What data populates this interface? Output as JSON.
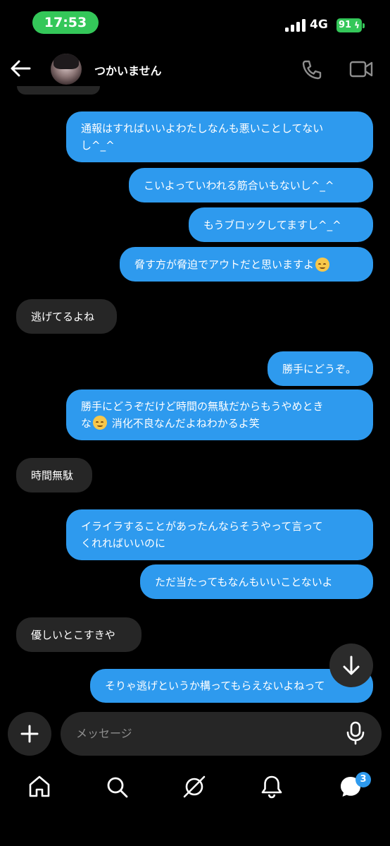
{
  "status_bar": {
    "time": "17:53",
    "network": "4G",
    "battery": "91"
  },
  "header": {
    "contact_name": "つかいません"
  },
  "messages": [
    {
      "side": "sent",
      "lines": [
        "通報はすればいいよわたしなんも悪いことしてない",
        "し^_^"
      ]
    },
    {
      "side": "sent",
      "text": "こいよっていわれる筋合いもないし^_^"
    },
    {
      "side": "sent",
      "text": "もうブロックしてますし^_^"
    },
    {
      "side": "sent",
      "text": "脅す方が脅迫でアウトだと思いますよ",
      "emoji": "relieved-face"
    },
    {
      "side": "received",
      "text": "逃げてるよね"
    },
    {
      "side": "sent",
      "text": "勝手にどうぞ。"
    },
    {
      "side": "sent",
      "line1": "勝手にどうぞだけど時間の無駄だからもうやめとき",
      "line2_pre": "な",
      "line2_post": " 消化不良なんだよねわかるよ笑",
      "emoji": "relieved-face"
    },
    {
      "side": "received",
      "text": "時間無駄"
    },
    {
      "side": "sent",
      "lines": [
        "イライラすることがあったんならそうやって言って",
        "くれればいいのに"
      ]
    },
    {
      "side": "sent",
      "text": "ただ当たってもなんもいいことないよ"
    },
    {
      "side": "received",
      "text": "優しいとこすきや"
    },
    {
      "side": "sent",
      "text": "そりゃ逃げというか構ってもらえないよねって"
    }
  ],
  "composer": {
    "placeholder": "メッセージ"
  },
  "tab_bar": {
    "items": [
      "home-icon",
      "search-icon",
      "explore-icon",
      "notifications-icon",
      "messages-icon"
    ],
    "messages_badge": "3"
  },
  "colors": {
    "sent_bubble": "#2e9aee",
    "received_bubble": "#262626",
    "time_pill": "#34c759",
    "background": "#000000"
  }
}
